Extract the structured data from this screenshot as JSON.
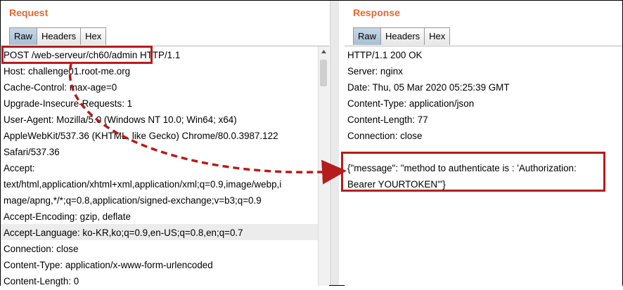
{
  "request": {
    "title": "Request",
    "tabs": [
      "Raw",
      "Headers",
      "Hex"
    ],
    "active_tab": "Raw",
    "lines": [
      "POST /web-serveur/ch60/admin HTTP/1.1",
      "Host: challenge01.root-me.org",
      "Cache-Control: max-age=0",
      "Upgrade-Insecure-Requests: 1",
      "User-Agent: Mozilla/5.0 (Windows NT 10.0; Win64; x64)",
      "AppleWebKit/537.36 (KHTML, like Gecko) Chrome/80.0.3987.122",
      "Safari/537.36",
      "Accept:",
      "text/html,application/xhtml+xml,application/xml;q=0.9,image/webp,i",
      "mage/apng,*/*;q=0.8,application/signed-exchange;v=b3;q=0.9",
      "Accept-Encoding: gzip, deflate",
      "Accept-Language: ko-KR,ko;q=0.9,en-US;q=0.8,en;q=0.7",
      "Connection: close",
      "Content-Type: application/x-www-form-urlencoded",
      "Content-Length: 0"
    ]
  },
  "response": {
    "title": "Response",
    "tabs": [
      "Raw",
      "Headers",
      "Hex"
    ],
    "active_tab": "Raw",
    "lines": [
      "HTTP/1.1 200 OK",
      "Server: nginx",
      "Date: Thu, 05 Mar 2020 05:25:39 GMT",
      "Content-Type: application/json",
      "Content-Length: 77",
      "Connection: close",
      "",
      "{\"message\": \"method to authenticate is : 'Authorization:",
      "Bearer YOURTOKEN'\"}"
    ]
  },
  "colors": {
    "title": "#e8692a",
    "annotation": "#b51c1c",
    "active_tab": "#b7cadc"
  }
}
